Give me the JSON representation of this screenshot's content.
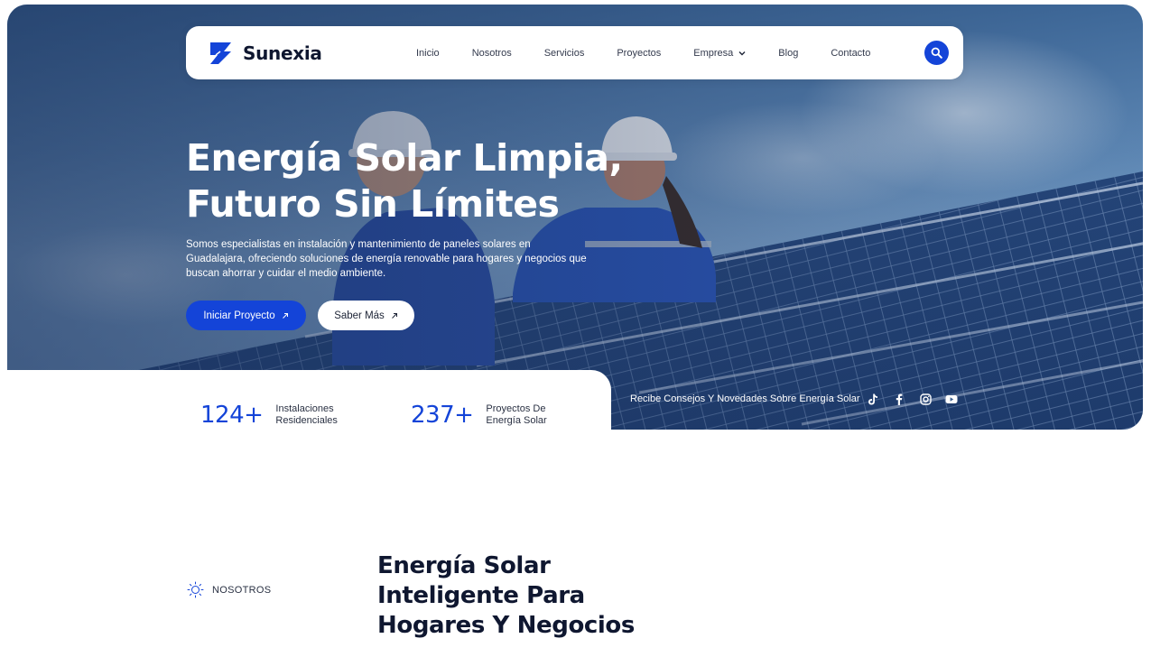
{
  "brand": {
    "name": "Sunexia",
    "accent": "#1444d8",
    "text_dark": "#0f1730"
  },
  "nav": {
    "items": [
      {
        "label": "Inicio"
      },
      {
        "label": "Nosotros"
      },
      {
        "label": "Servicios"
      },
      {
        "label": "Proyectos"
      },
      {
        "label": "Empresa",
        "has_dropdown": true
      },
      {
        "label": "Blog"
      },
      {
        "label": "Contacto"
      }
    ],
    "search_icon": "search-icon"
  },
  "hero": {
    "title_line1": "Energía Solar Limpia,",
    "title_line2": "Futuro Sin Límites",
    "description": "Somos especialistas en instalación y mantenimiento de paneles solares en Guadalajara, ofreciendo soluciones de energía renovable para hogares y negocios que buscan ahorrar y cuidar el medio ambiente.",
    "primary_cta": "Iniciar Proyecto",
    "secondary_cta": "Saber Más"
  },
  "stats": [
    {
      "value": "124+",
      "label_line1": "Instalaciones",
      "label_line2": "Residenciales"
    },
    {
      "value": "237+",
      "label_line1": "Proyectos De",
      "label_line2": "Energía Solar"
    }
  ],
  "newsletter": {
    "text": "Recibe Consejos Y Novedades Sobre Energía Solar",
    "socials": [
      "tiktok-icon",
      "facebook-icon",
      "instagram-icon",
      "youtube-icon"
    ]
  },
  "about": {
    "tag": "NOSOTROS",
    "title_line1": "Energía Solar",
    "title_line2": "Inteligente Para",
    "title_line3": "Hogares Y Negocios"
  }
}
